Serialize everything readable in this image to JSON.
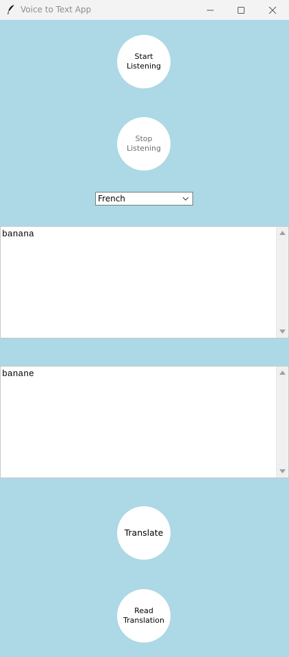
{
  "window": {
    "title": "Voice to Text App",
    "icon": "feather-icon"
  },
  "buttons": {
    "start": "Start\nListening",
    "stop": "Stop\nListening",
    "translate": "Translate",
    "read": "Read\nTranslation"
  },
  "language_select": {
    "selected": "French"
  },
  "input_text": "banana",
  "output_text": "banane",
  "colors": {
    "background": "#add8e6",
    "button": "#ffffff",
    "titlebar": "#f3f3f3"
  }
}
